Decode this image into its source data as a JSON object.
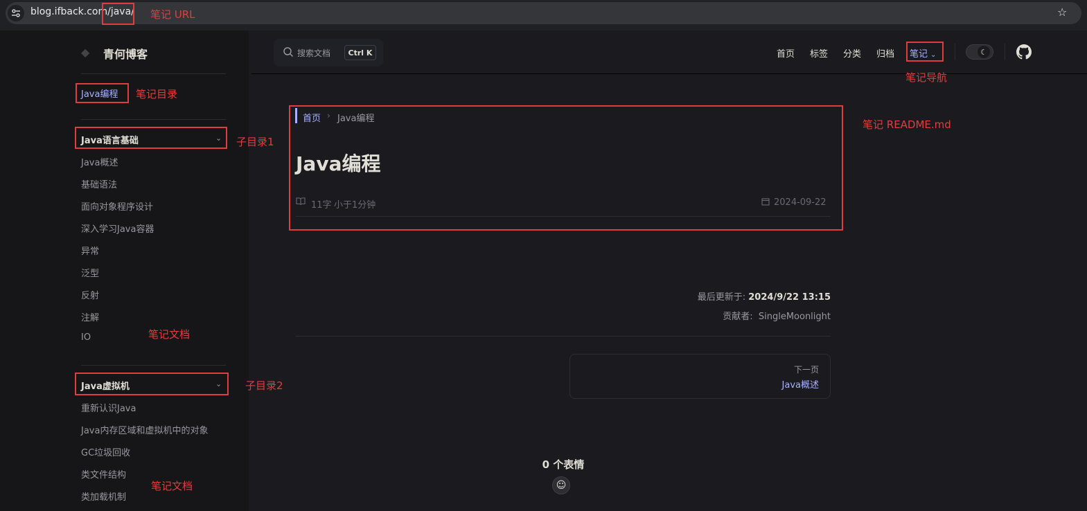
{
  "browser": {
    "url_host": "blog.ifback.com",
    "url_path": "/java/"
  },
  "sidebar": {
    "brand": "青何博客",
    "root": "Java编程",
    "group1": {
      "title": "Java语言基础",
      "items": [
        "Java概述",
        "基础语法",
        "面向对象程序设计",
        "深入学习Java容器",
        "异常",
        "泛型",
        "反射",
        "注解",
        "IO"
      ]
    },
    "group2": {
      "title": "Java虚拟机",
      "items": [
        "重新认识Java",
        "Java内存区域和虚拟机中的对象",
        "GC垃圾回收",
        "类文件结构",
        "类加载机制"
      ]
    }
  },
  "nav": {
    "search_placeholder": "搜索文档",
    "search_key": "Ctrl K",
    "links": [
      "首页",
      "标签",
      "分类",
      "归档"
    ],
    "notes": "笔记"
  },
  "article": {
    "breadcrumb_home": "首页",
    "breadcrumb_current": "Java编程",
    "title": "Java编程",
    "word_count": "11字",
    "read_time": "小于1分钟",
    "date": "2024-09-22",
    "updated_label": "最后更新于:",
    "updated_value": "2024/9/22 13:15",
    "contrib_label": "贡献者:",
    "contrib_value": "SingleMoonlight",
    "next_label": "下一页",
    "next_title": "Java概述",
    "reactions": "0 个表情"
  },
  "annotations": {
    "url": "笔记 URL",
    "nav": "笔记导航",
    "toc": "笔记目录",
    "readme": "笔记 README.md",
    "sub1": "子目录1",
    "sub2": "子目录2",
    "doc": "笔记文档"
  },
  "colors": {
    "accent": "#a8b1ff",
    "annotation": "#e03e3e",
    "background": "#1b1b1f",
    "sidebar": "#161618"
  }
}
